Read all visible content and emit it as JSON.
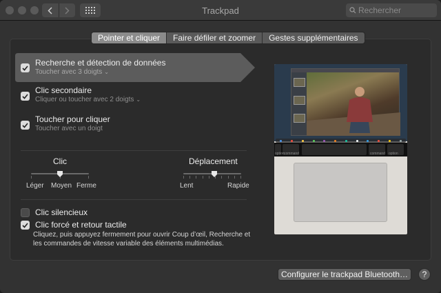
{
  "window": {
    "title": "Trackpad"
  },
  "toolbar": {
    "back_icon": "chevron-left-icon",
    "forward_icon": "chevron-right-icon",
    "show_all_icon": "grid-icon"
  },
  "search": {
    "placeholder": "Rechercher"
  },
  "tabs": [
    {
      "label": "Pointer et cliquer",
      "active": true
    },
    {
      "label": "Faire défiler et zoomer",
      "active": false
    },
    {
      "label": "Gestes supplémentaires",
      "active": false
    }
  ],
  "options": {
    "lookup": {
      "title": "Recherche et détection de données",
      "sub": "Toucher avec 3 doigts",
      "checked": true,
      "selected": true
    },
    "secondary": {
      "title": "Clic secondaire",
      "sub": "Cliquer ou toucher avec 2 doigts",
      "checked": true
    },
    "tap": {
      "title": "Toucher pour cliquer",
      "sub": "Toucher avec un doigt",
      "checked": true
    },
    "silent": {
      "title": "Clic silencieux",
      "checked": false
    },
    "force": {
      "title": "Clic forcé et retour tactile",
      "checked": true,
      "desc": "Cliquez, puis appuyez fermement pour ouvrir Coup d’œil, Recherche et les commandes de vitesse variable des éléments multimédias."
    }
  },
  "click_slider": {
    "title": "Clic",
    "min": "Léger",
    "mid": "Moyen",
    "max": "Ferme",
    "level": 0.5
  },
  "tracking_slider": {
    "title": "Déplacement",
    "min": "Lent",
    "max": "Rapide",
    "level": 0.6
  },
  "touchbar": {
    "left": "option",
    "cmd_left": "command",
    "cmd_right": "command",
    "right": "option"
  },
  "bluetooth_button": "Configurer le trackpad Bluetooth…",
  "help_button": "?"
}
